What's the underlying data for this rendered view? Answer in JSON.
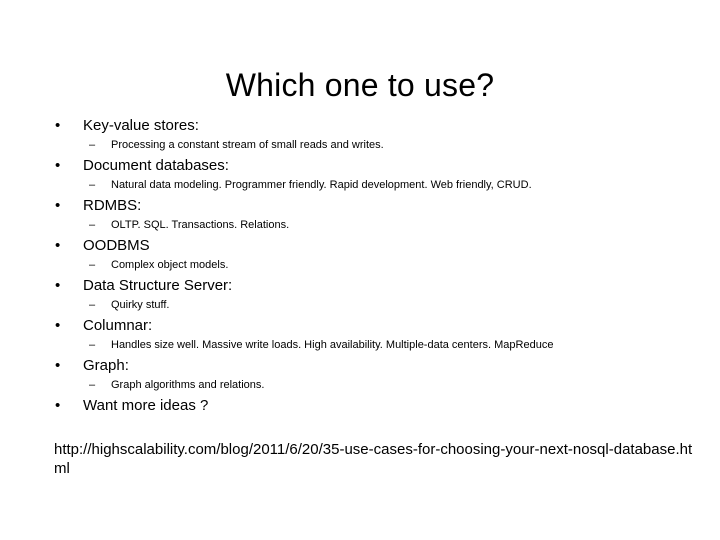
{
  "slide": {
    "title": "Which one to use?",
    "bullet_marker": "•",
    "sub_marker": "–",
    "items": [
      {
        "label": "Key-value stores:",
        "detail": "Processing a constant stream of small reads and writes."
      },
      {
        "label": "Document databases:",
        "detail": "Natural data modeling. Programmer friendly. Rapid development. Web friendly, CRUD."
      },
      {
        "label": "RDMBS:",
        "detail": "OLTP. SQL. Transactions. Relations."
      },
      {
        "label": "OODBMS",
        "detail": "Complex object models."
      },
      {
        "label": "Data Structure Server:",
        "detail": "Quirky stuff."
      },
      {
        "label": "Columnar:",
        "detail": "Handles size well. Massive write loads. High availability. Multiple-data centers. MapReduce"
      },
      {
        "label": "Graph:",
        "detail": "Graph algorithms and relations."
      },
      {
        "label": "Want more ideas ?",
        "detail": null
      }
    ],
    "source_url": "http://highscalability.com/blog/2011/6/20/35-use-cases-for-choosing-your-next-nosql-database.html"
  }
}
